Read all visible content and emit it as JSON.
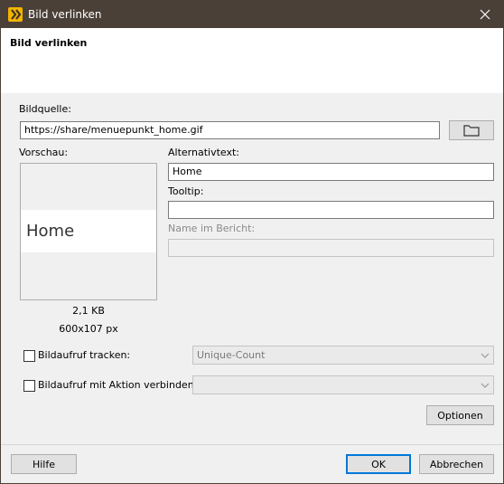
{
  "window": {
    "title": "Bild verlinken",
    "close_icon": "close-icon"
  },
  "banner": {
    "title": "Bild verlinken"
  },
  "source": {
    "label": "Bildquelle:",
    "value": "https://share/menuepunkt_home.gif",
    "browse_icon": "folder-icon"
  },
  "preview": {
    "label": "Vorschau:",
    "image_text": "Home",
    "size": "2,1 KB",
    "dimensions": "600x107 px"
  },
  "alt_text": {
    "label": "Alternativtext:",
    "value": "Home"
  },
  "tooltip": {
    "label": "Tooltip:",
    "value": ""
  },
  "report_name": {
    "label": "Name im Bericht:",
    "value": ""
  },
  "tracking": {
    "label": "Bildaufruf tracken:",
    "checked": false,
    "select_value": "Unique-Count"
  },
  "action": {
    "label": "Bildaufruf mit Aktion verbinden:",
    "checked": false,
    "select_value": ""
  },
  "buttons": {
    "options": "Optionen",
    "help": "Hilfe",
    "ok": "OK",
    "cancel": "Abbrechen"
  },
  "colors": {
    "titlebar": "#4b4038",
    "accent_default_button": "#0078d7",
    "app_icon": "#f2b400"
  }
}
